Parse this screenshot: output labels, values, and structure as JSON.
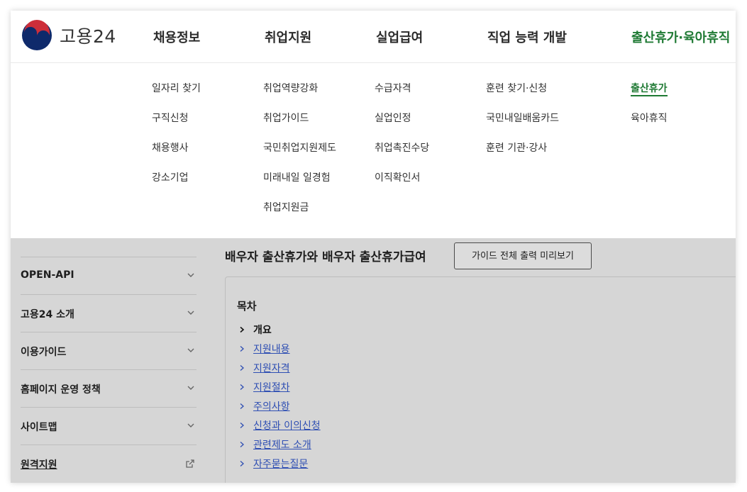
{
  "header": {
    "logo_text": "고용24",
    "nav": [
      {
        "label": "채용정보"
      },
      {
        "label": "취업지원"
      },
      {
        "label": "실업급여"
      },
      {
        "label": "직업 능력 개발"
      },
      {
        "label": "출산휴가·육아휴직"
      }
    ],
    "active_nav": "출산휴가·육아휴직",
    "accent_color": "#1f7a34"
  },
  "mega_menu": {
    "columns": [
      {
        "items": [
          "일자리 찾기",
          "구직신청",
          "채용행사",
          "강소기업"
        ]
      },
      {
        "items": [
          "취업역량강화",
          "취업가이드",
          "국민취업지원제도",
          "미래내일 일경험",
          "취업지원금"
        ]
      },
      {
        "items": [
          "수급자격",
          "실업인정",
          "취업촉진수당",
          "이직확인서"
        ]
      },
      {
        "items": [
          "훈련 찾기·신청",
          "국민내일배움카드",
          "훈련 기관·강사"
        ]
      },
      {
        "items": [
          "출산휴가",
          "육아휴직"
        ]
      }
    ],
    "active_item": "출산휴가"
  },
  "sidebar": {
    "items": [
      {
        "label": "",
        "icon": "none"
      },
      {
        "label": "OPEN-API",
        "icon": "chevron-down-icon"
      },
      {
        "label": "고용24 소개",
        "icon": "chevron-down-icon"
      },
      {
        "label": "이용가이드",
        "icon": "chevron-down-icon"
      },
      {
        "label": "홈페이지 운영 정책",
        "icon": "chevron-down-icon"
      },
      {
        "label": "사이트맵",
        "icon": "chevron-down-icon"
      },
      {
        "label": "원격지원",
        "icon": "external-link-icon"
      }
    ]
  },
  "main": {
    "title": "배우자 출산휴가와 배우자 출산휴가급여",
    "print_button": "가이드 전체 출력 미리보기",
    "toc": {
      "title": "목차",
      "items": [
        "개요",
        "지원내용",
        "지원자격",
        "지원절차",
        "주의사항",
        "신청과 이의신청",
        "관련제도 소개",
        "자주묻는질문"
      ],
      "current": "개요"
    },
    "link_color": "#2f4fb3"
  }
}
